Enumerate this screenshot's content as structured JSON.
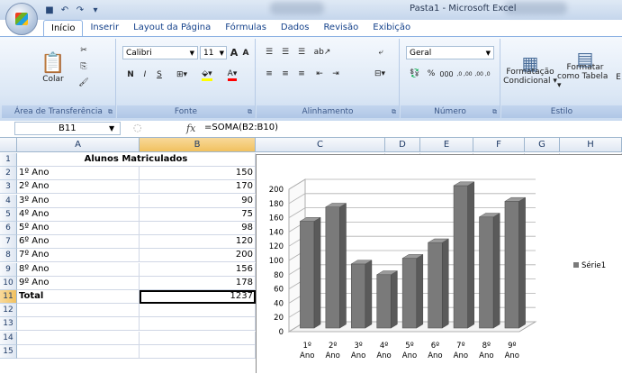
{
  "window": {
    "title": "Pasta1 - Microsoft Excel",
    "qat_icons": [
      "save-icon",
      "undo-icon",
      "redo-icon",
      "customize-icon"
    ]
  },
  "tabs": [
    "Início",
    "Inserir",
    "Layout da Página",
    "Fórmulas",
    "Dados",
    "Revisão",
    "Exibição"
  ],
  "active_tab": "Início",
  "ribbon": {
    "clipboard": {
      "label": "Área de Transferência",
      "paste": "Colar"
    },
    "font": {
      "label": "Fonte",
      "name": "Calibri",
      "size": "11",
      "grow": "A",
      "shrink": "A",
      "bold": "N",
      "italic": "I",
      "underline": "S"
    },
    "alignment": {
      "label": "Alinhamento"
    },
    "number": {
      "label": "Número",
      "format": "Geral",
      "percent": "%",
      "thousands": "000",
      "inc_dec": ",0 ,00",
      "dec_dec": ",00 ,0"
    },
    "styles": {
      "label": "Estilo",
      "conditional_1": "Formatação",
      "conditional_2": "Condicional",
      "table_1": "Formatar",
      "table_2": "como Tabela",
      "cut_text": "E"
    }
  },
  "formula_bar": {
    "name_box": "B11",
    "fx": "fx",
    "formula": "=SOMA(B2:B10)"
  },
  "columns": [
    "A",
    "B",
    "C",
    "D",
    "E",
    "F",
    "G",
    "H"
  ],
  "rows": [
    "1",
    "2",
    "3",
    "4",
    "5",
    "6",
    "7",
    "8",
    "9",
    "10",
    "11",
    "12",
    "13",
    "14",
    "15"
  ],
  "sheet": {
    "header": "Alunos Matriculados",
    "data": [
      {
        "label": "1º Ano",
        "value": "150"
      },
      {
        "label": "2º Ano",
        "value": "170"
      },
      {
        "label": "3º Ano",
        "value": "90"
      },
      {
        "label": "4º Ano",
        "value": "75"
      },
      {
        "label": "5º Ano",
        "value": "98"
      },
      {
        "label": "6º Ano",
        "value": "120"
      },
      {
        "label": "7º Ano",
        "value": "200"
      },
      {
        "label": "8º Ano",
        "value": "156"
      },
      {
        "label": "9º Ano",
        "value": "178"
      }
    ],
    "total_label": "Total",
    "total_value": "1237"
  },
  "chart_data": {
    "type": "bar",
    "categories_top": [
      "1º",
      "2º",
      "3º",
      "4º",
      "5º",
      "6º",
      "7º",
      "8º",
      "9º"
    ],
    "categories_bottom": [
      "Ano",
      "Ano",
      "Ano",
      "Ano",
      "Ano",
      "Ano",
      "Ano",
      "Ano",
      "Ano"
    ],
    "series": [
      {
        "name": "Série1",
        "values": [
          150,
          170,
          90,
          75,
          98,
          120,
          200,
          156,
          178
        ]
      }
    ],
    "ylim": [
      0,
      200
    ],
    "yticks": [
      "0",
      "20",
      "40",
      "60",
      "80",
      "100",
      "120",
      "140",
      "160",
      "180",
      "200"
    ],
    "legend": "right",
    "grid": true,
    "bar_color": "#7a7a7a"
  }
}
